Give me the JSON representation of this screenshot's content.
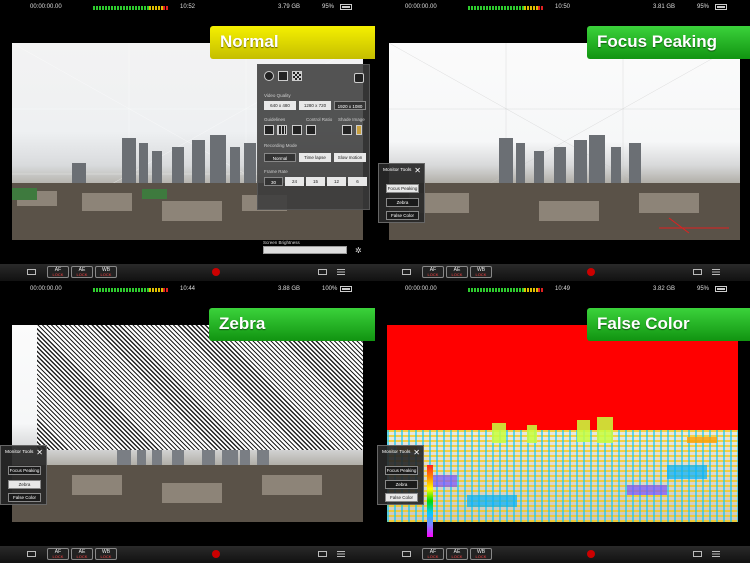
{
  "panels": [
    {
      "mode_label": "Normal",
      "timecode": "00:00:00.00",
      "clock": "10:52",
      "storage": "3.79 GB",
      "battery": "95%"
    },
    {
      "mode_label": "Focus Peaking",
      "timecode": "00:00:00.00",
      "clock": "10:50",
      "storage": "3.81 GB",
      "battery": "95%"
    },
    {
      "mode_label": "Zebra",
      "timecode": "00:00:00.00",
      "clock": "10:44",
      "storage": "3.88 GB",
      "battery": "100%"
    },
    {
      "mode_label": "False Color",
      "timecode": "00:00:00.00",
      "clock": "10:49",
      "storage": "3.82 GB",
      "battery": "95%"
    }
  ],
  "bottom_bar": {
    "af": "AF",
    "ae": "AE",
    "wb": "WB",
    "lock": "LOCK"
  },
  "settings_panel": {
    "video_quality_label": "Video Quality",
    "resolutions": [
      "640 x 480",
      "1280 x 720",
      "1920 x 1080"
    ],
    "resolution_selected": "1920 x 1080",
    "guidelines_label": "Guidelines",
    "control_ratio_label": "Control Ratio",
    "shade_image_label": "Shade Image",
    "recording_mode_label": "Recording Mode",
    "modes": [
      "Normal",
      "Time lapse",
      "Slow motion"
    ],
    "mode_selected": "Normal",
    "frame_rate_label": "Frame Rate",
    "frame_rates": [
      "30",
      "24",
      "15",
      "12",
      "6"
    ],
    "frame_rate_selected": "30",
    "brightness_label": "Screen Brightness"
  },
  "monitor_tools": {
    "title": "Monitor Tools",
    "buttons": [
      "Focus Peaking",
      "Zebra",
      "False Color"
    ]
  },
  "colors": {
    "normal_badge": "#f0e800",
    "mode_badge": "#22b022",
    "false_color_red": "#ff0000",
    "record": "#cc0000"
  }
}
